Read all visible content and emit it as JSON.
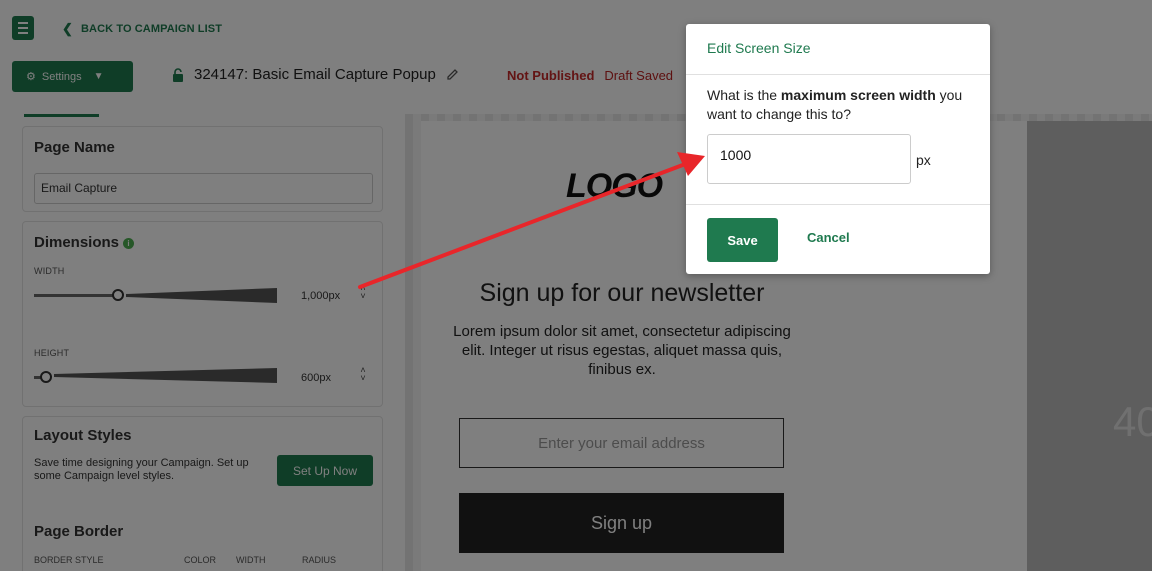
{
  "header": {
    "back_label": "BACK TO CAMPAIGN LIST",
    "settings_label": "Settings",
    "campaign_title": "324147: Basic Email Capture Popup",
    "status_published": "Not Published",
    "status_draft": "Draft Saved"
  },
  "sidebar": {
    "page_name": {
      "title": "Page Name",
      "value": "Email Capture"
    },
    "dimensions": {
      "title": "Dimensions",
      "width_label": "WIDTH",
      "width_value": "1,000px",
      "height_label": "HEIGHT",
      "height_value": "600px"
    },
    "layout_styles": {
      "title": "Layout Styles",
      "description": "Save time designing your Campaign. Set up some Campaign level styles.",
      "button_label": "Set Up Now"
    },
    "page_border": {
      "title": "Page Border",
      "col_border_style": "BORDER STYLE",
      "col_color": "COLOR",
      "col_width": "WIDTH",
      "col_radius": "RADIUS"
    }
  },
  "preview": {
    "logo": "LOGO",
    "headline": "Sign up for our newsletter",
    "body": "Lorem ipsum dolor sit amet, consectetur adipiscing elit. Integer ut risus egestas, aliquet massa quis, finibus ex.",
    "email_placeholder": "Enter your email address",
    "signup_label": "Sign up",
    "side_number": "40"
  },
  "modal": {
    "title": "Edit Screen Size",
    "question_prefix": "What is the ",
    "question_bold": "maximum screen width",
    "question_suffix": " you want to change this to?",
    "input_value": "1000",
    "unit": "px",
    "save_label": "Save",
    "cancel_label": "Cancel"
  },
  "colors": {
    "brand_green": "#1f7a4f",
    "status_red": "#c62828",
    "annotation_arrow": "#e8262a"
  },
  "icons": [
    "menu-icon",
    "chevron-left-icon",
    "gear-icon",
    "chevron-down-icon",
    "lock-icon",
    "pencil-icon",
    "info-icon"
  ]
}
